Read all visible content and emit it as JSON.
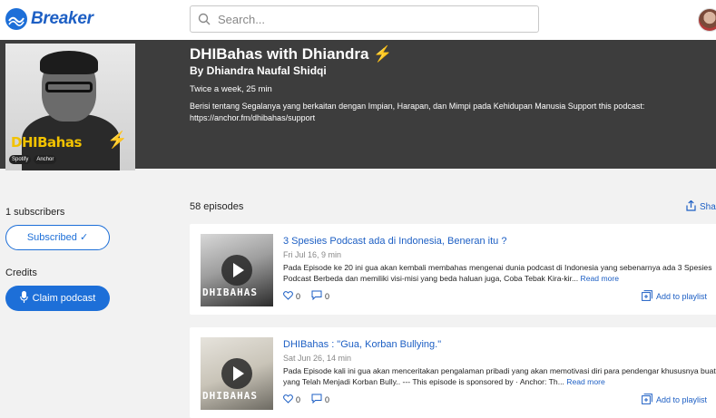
{
  "app": {
    "name": "Breaker"
  },
  "search": {
    "placeholder": "Search..."
  },
  "podcast": {
    "title": "DHIBahas with Dhiandra",
    "title_emoji": "⚡",
    "author": "By Dhiandra Naufal Shidqi",
    "frequency": "Twice a week, 25 min",
    "description": "Berisi tentang Segalanya yang berkaitan dengan Impian, Harapan, dan Mimpi pada Kehidupan Manusia Support this podcast: https://anchor.fm/dhibahas/support",
    "cover": {
      "brand_text": "DHIBahas",
      "badges": [
        "Spotify",
        "Anchor"
      ]
    }
  },
  "sidebar": {
    "subscribers": "1 subscribers",
    "subscribed_label": "Subscribed",
    "credits_label": "Credits",
    "claim_label": "Claim podcast"
  },
  "episodes_header": {
    "count": "58 episodes",
    "share_label": "Shar"
  },
  "episodes": [
    {
      "title": "3 Spesies Podcast ada di Indonesia, Beneran itu ?",
      "meta": "Fri Jul 16, 9 min",
      "description": "Pada Episode ke 20 ini gua akan kembali membahas mengenai dunia podcast di Indonesia yang sebenarnya ada 3 Spesies Podcast Berbeda dan memiliki visi-misi yang beda haluan juga, Coba Tebak Kira-kir...",
      "read_more": "Read more",
      "likes": "0",
      "comments": "0",
      "playlist_label": "Add to playlist",
      "thumb_text": "DHIBAHAS"
    },
    {
      "title": "DHIBahas : \"Gua, Korban Bullying.\"",
      "meta": "Sat Jun 26, 14 min",
      "description": "Pada Episode kali ini gua akan menceritakan pengalaman pribadi yang akan memotivasi diri para pendengar khususnya buat yang Telah Menjadi Korban Bully.. --- This episode is sponsored by · Anchor: Th...",
      "read_more": "Read more",
      "likes": "0",
      "comments": "0",
      "playlist_label": "Add to playlist",
      "thumb_text": "DHIBAHAS"
    }
  ],
  "colors": {
    "brand_blue": "#1d6fd8",
    "hero_bg": "#3d3d3d",
    "accent_yellow": "#f5c518"
  }
}
